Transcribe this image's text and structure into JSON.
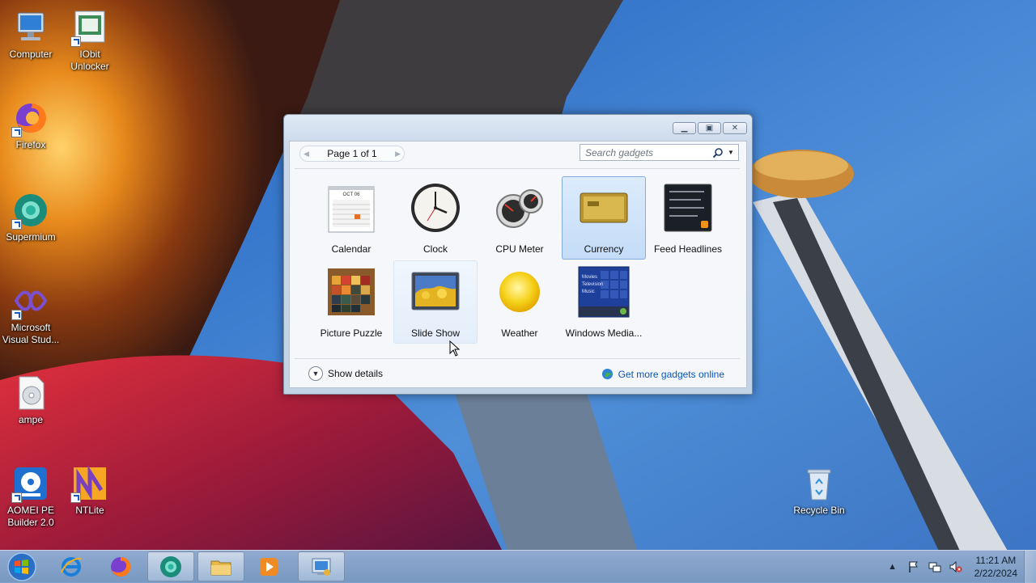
{
  "desktop": {
    "icons": [
      {
        "label": "Computer",
        "icon": "computer-icon"
      },
      {
        "label": "IObit Unlocker",
        "icon": "iobit-unlocker-icon"
      },
      {
        "label": "Firefox",
        "icon": "firefox-icon"
      },
      {
        "label": "Supermium",
        "icon": "supermium-icon"
      },
      {
        "label": "Microsoft Visual Stud...",
        "icon": "visual-studio-icon"
      },
      {
        "label": "ampe",
        "icon": "disc-file-icon"
      },
      {
        "label": "AOMEI PE Builder 2.0",
        "icon": "aomei-pe-builder-icon"
      },
      {
        "label": "NTLite",
        "icon": "ntlite-icon"
      },
      {
        "label": "Recycle Bin",
        "icon": "recycle-bin-icon"
      }
    ]
  },
  "gallery": {
    "window_buttons": {
      "minimize": "minimize-icon",
      "restore": "restore-icon",
      "close": "close-icon"
    },
    "pager_text": "Page 1 of 1",
    "search_placeholder": "Search gadgets",
    "gadgets": [
      {
        "name": "Calendar",
        "state": "normal"
      },
      {
        "name": "Clock",
        "state": "normal"
      },
      {
        "name": "CPU Meter",
        "state": "normal"
      },
      {
        "name": "Currency",
        "state": "selected"
      },
      {
        "name": "Feed Headlines",
        "state": "normal"
      },
      {
        "name": "Picture Puzzle",
        "state": "normal"
      },
      {
        "name": "Slide Show",
        "state": "hover"
      },
      {
        "name": "Weather",
        "state": "normal"
      },
      {
        "name": "Windows Media...",
        "state": "normal"
      }
    ],
    "calendar_thumb": {
      "month": "OCT 06"
    },
    "media_thumb": {
      "lines": [
        "Movies",
        "Television",
        "Music"
      ]
    },
    "show_details": "Show details",
    "get_more": "Get more gadgets online"
  },
  "taskbar": {
    "apps": [
      "internet-explorer-icon",
      "firefox-icon",
      "supermium-icon",
      "file-explorer-icon",
      "media-player-icon",
      "gadgets-icon"
    ],
    "clock_time": "11:21 AM",
    "clock_date": "2/22/2024"
  },
  "colors": {
    "selection": "#c4dcf7",
    "link": "#0a55b8",
    "sky": "#3a78c8"
  }
}
